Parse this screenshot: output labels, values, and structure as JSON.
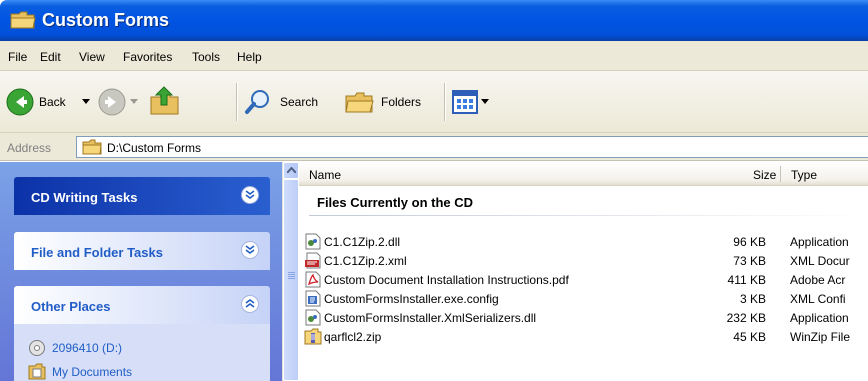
{
  "window": {
    "title": "Custom Forms",
    "title_icon": "folder-icon"
  },
  "menu": [
    "File",
    "Edit",
    "View",
    "Favorites",
    "Tools",
    "Help"
  ],
  "toolbar": {
    "back_label": "Back",
    "search_label": "Search",
    "folders_label": "Folders"
  },
  "address": {
    "label": "Address",
    "value": "D:\\Custom Forms"
  },
  "task_pane": {
    "cd_tasks": "CD Writing Tasks",
    "file_tasks": "File and Folder Tasks",
    "other_places": "Other Places",
    "places": [
      {
        "label": "2096410 (D:)",
        "icon": "cd-drive-icon"
      },
      {
        "label": "My Documents",
        "icon": "my-documents-icon"
      }
    ]
  },
  "columns": {
    "name": "Name",
    "size": "Size",
    "type": "Type"
  },
  "group_title": "Files Currently on the CD",
  "files": [
    {
      "name": "C1.C1Zip.2.dll",
      "size": "96 KB",
      "type": "Application",
      "icon": "dll-icon"
    },
    {
      "name": "C1.C1Zip.2.xml",
      "size": "73 KB",
      "type": "XML Docur",
      "icon": "xml-icon"
    },
    {
      "name": "Custom Document Installation Instructions.pdf",
      "size": "411 KB",
      "type": "Adobe Acr",
      "icon": "pdf-icon"
    },
    {
      "name": "CustomFormsInstaller.exe.config",
      "size": "3 KB",
      "type": "XML Confi",
      "icon": "config-icon"
    },
    {
      "name": "CustomFormsInstaller.XmlSerializers.dll",
      "size": "232 KB",
      "type": "Application",
      "icon": "dll-icon"
    },
    {
      "name": "qarflcl2.zip",
      "size": "45 KB",
      "type": "WinZip File",
      "icon": "zip-icon"
    }
  ]
}
